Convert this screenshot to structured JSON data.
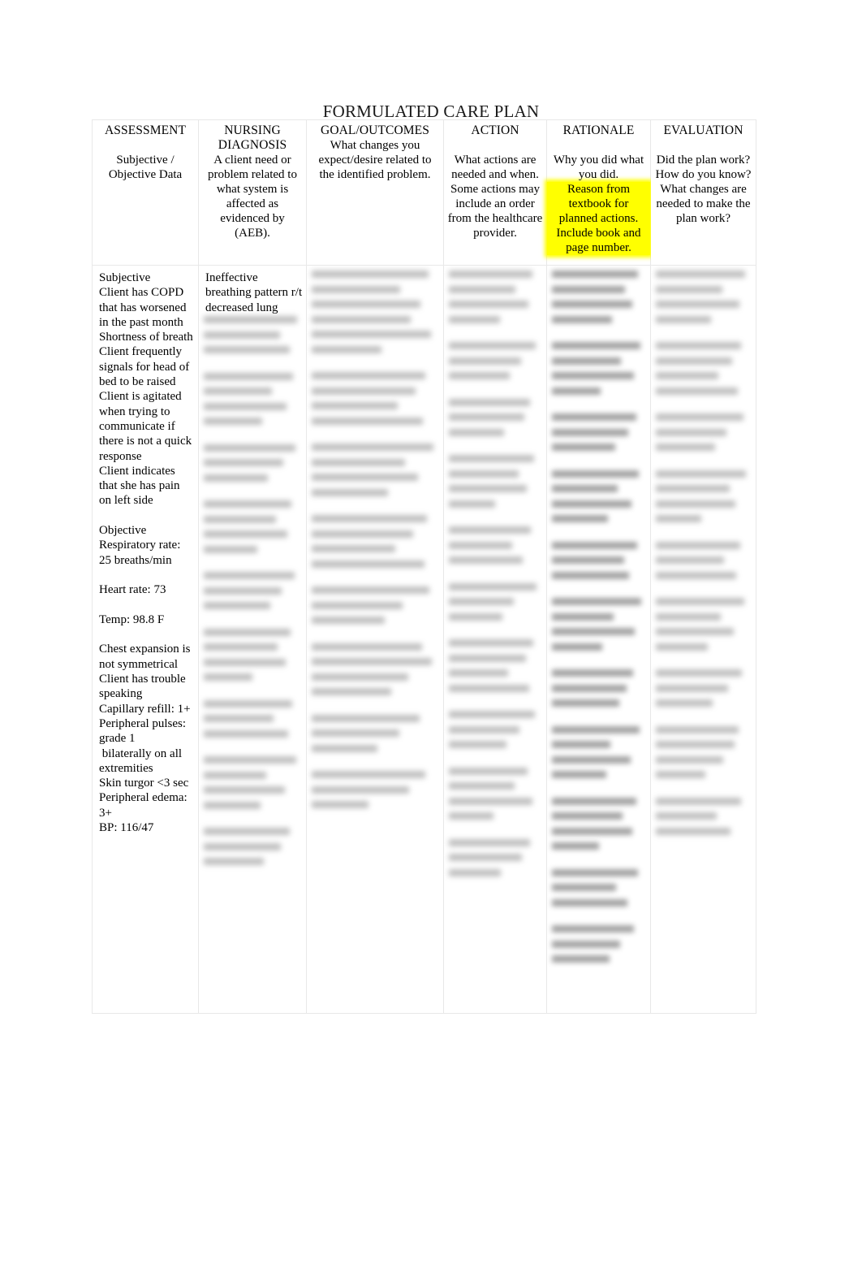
{
  "document": {
    "title": "FORMULATED CARE PLAN"
  },
  "table": {
    "columns": [
      {
        "key": "assessment",
        "header": "ASSESSMENT",
        "description": "Subjective / Objective Data",
        "highlighted": false
      },
      {
        "key": "nursing_diagnosis",
        "header": "NURSING DIAGNOSIS",
        "description": "A client need or problem related to what system is affected as evidenced by (AEB).",
        "highlighted": false
      },
      {
        "key": "goal_outcomes",
        "header": "GOAL/OUTCOMES",
        "description": "What changes you expect/desire related to the identified problem.",
        "highlighted": false
      },
      {
        "key": "action",
        "header": "ACTION",
        "description": "What actions are needed and when. Some actions may include an order from the healthcare provider.",
        "highlighted": false
      },
      {
        "key": "rationale",
        "header": "RATIONALE",
        "description_plain": "Why you did what you did.",
        "description_highlighted": "Reason from textbook for planned actions. Include book and page number.",
        "highlighted": true,
        "highlight_color": "#ffff00"
      },
      {
        "key": "evaluation",
        "header": "EVALUATION",
        "description": "Did the plan work? How do you know? What changes are needed to make the plan work?",
        "highlighted": false
      }
    ],
    "row": {
      "assessment": "Subjective\nClient has COPD that has worsened in the past month\nShortness of breath\nClient frequently signals for head of bed to be raised\nClient is agitated when trying to communicate if there is not a quick response\nClient indicates that she has pain on left side\n\nObjective\nRespiratory rate: 25 breaths/min\n\nHeart rate: 73\n\nTemp: 98.8 F\n\nChest expansion is not symmetrical\nClient has trouble speaking\nCapillary refill: 1+\nPeripheral pulses: grade 1\n bilaterally on all extremities\nSkin turgor <3 sec\nPeripheral edema: 3+\nBP: 116/47",
      "nursing_diagnosis": "Ineffective breathing pattern r/t decreased lung",
      "goal_outcomes": "",
      "action": "",
      "rationale": "",
      "evaluation": ""
    },
    "redacted_note": "Content in the Nursing Diagnosis (below first lines), Goal/Outcomes, Action, Rationale and Evaluation body cells is blurred and unreadable."
  }
}
